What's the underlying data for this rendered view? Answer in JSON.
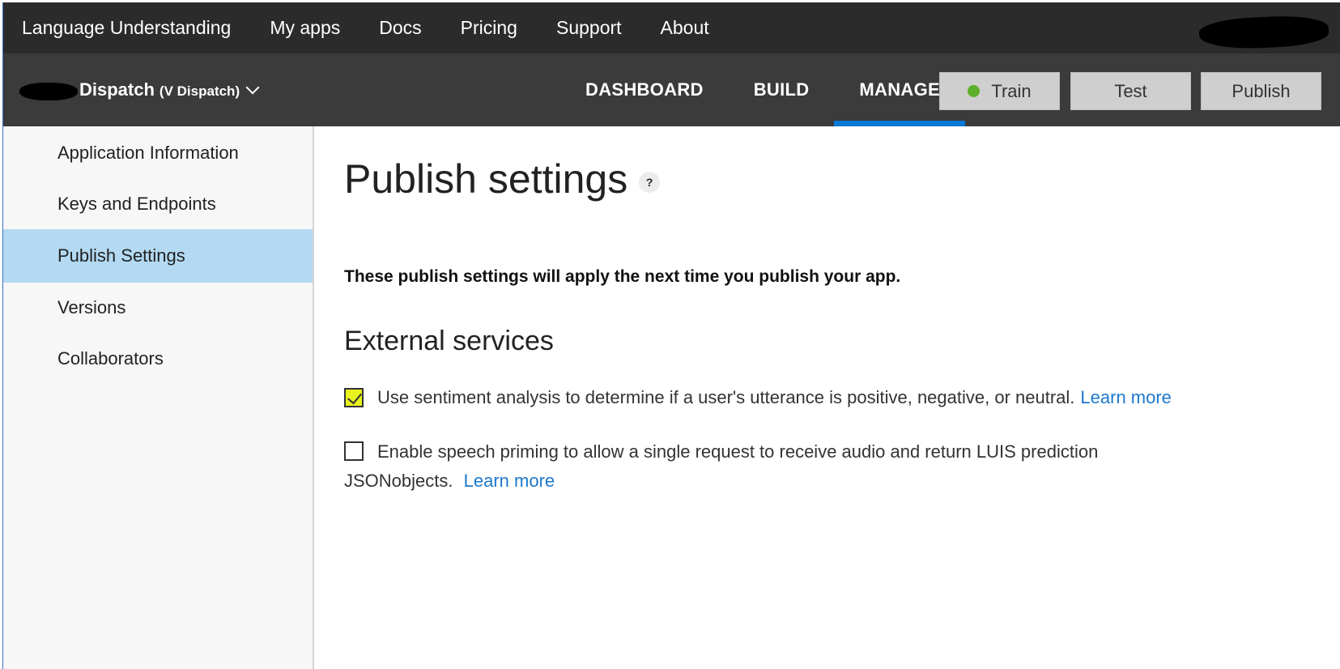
{
  "topnav": {
    "brand": "Language Understanding",
    "items": [
      "My apps",
      "Docs",
      "Pricing",
      "Support",
      "About"
    ]
  },
  "app": {
    "name": "Dispatch",
    "version": "(V Dispatch)"
  },
  "tabs": [
    "DASHBOARD",
    "BUILD",
    "MANAGE"
  ],
  "active_tab": "MANAGE",
  "actions": {
    "train": "Train",
    "test": "Test",
    "publish": "Publish"
  },
  "sidebar": {
    "items": [
      "Application Information",
      "Keys and Endpoints",
      "Publish Settings",
      "Versions",
      "Collaborators"
    ],
    "active": "Publish Settings"
  },
  "main": {
    "title": "Publish settings",
    "help": "?",
    "intro": "These publish settings will apply the next time you publish your app.",
    "section": "External services",
    "options": [
      {
        "label": "Use sentiment analysis to determine if a user's utterance is positive, negative, or neutral.",
        "link": "Learn more",
        "checked": true
      },
      {
        "label": "Enable speech priming to allow a single request to receive audio and return LUIS prediction JSONobjects.",
        "link": "Learn more",
        "checked": false
      }
    ]
  },
  "colors": {
    "topbar": "#2b2b2b",
    "appbar": "#3b3b3b",
    "accent": "#0a78d4",
    "sidebar_active": "#b3daf2",
    "link": "#1d78cc",
    "checkbox_highlight": "#e8f31d",
    "train_status": "#5db12a"
  }
}
